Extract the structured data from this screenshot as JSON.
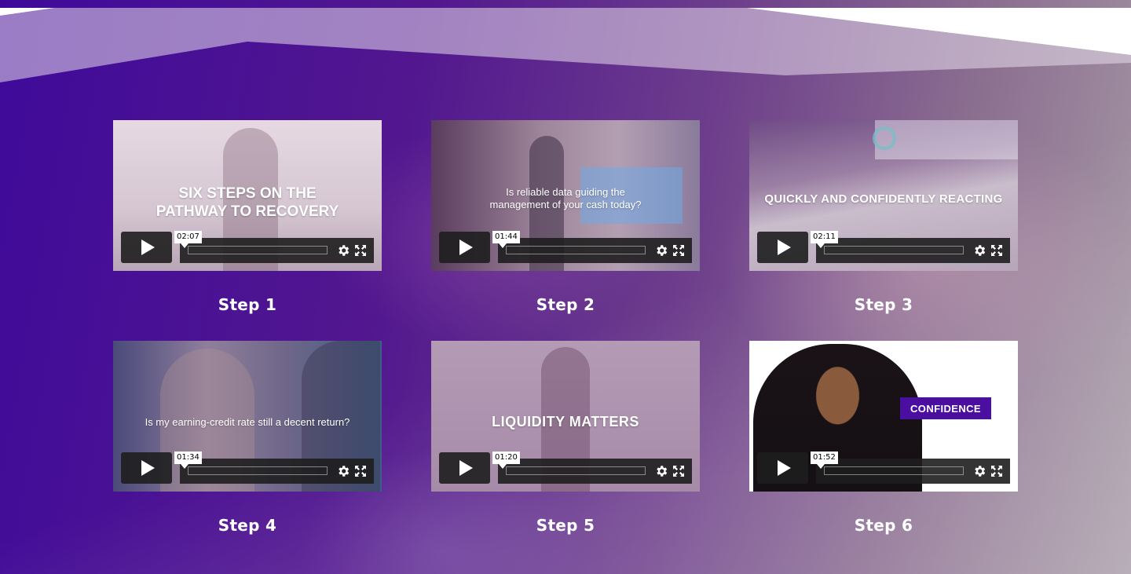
{
  "videos": [
    {
      "step_label": "Step 1",
      "overlay_line1": "SIX STEPS ON THE",
      "overlay_line2": "PATHWAY TO RECOVERY",
      "duration": "02:07",
      "palette": [
        "#e2d4dc",
        "#c7b6c3"
      ]
    },
    {
      "step_label": "Step 2",
      "overlay_line1": "Is reliable data guiding the",
      "overlay_line2": "management of your cash today?",
      "duration": "01:44",
      "palette": [
        "#8b6f8f",
        "#b59eb0"
      ]
    },
    {
      "step_label": "Step 3",
      "overlay_line1": "QUICKLY AND CONFIDENTLY REACTING",
      "overlay_line2": "",
      "duration": "02:11",
      "palette": [
        "#8a6a92",
        "#b6a0b8"
      ]
    },
    {
      "step_label": "Step 4",
      "overlay_line1": "Is my earning-credit rate still a decent return?",
      "overlay_line2": "",
      "duration": "01:34",
      "palette": [
        "#5d4a7a",
        "#9b8cab"
      ]
    },
    {
      "step_label": "Step 5",
      "overlay_line1": "LIQUIDITY MATTERS",
      "overlay_line2": "",
      "duration": "01:20",
      "palette": [
        "#a98eae",
        "#b79db6"
      ]
    },
    {
      "step_label": "Step 6",
      "overlay_line1": "CONFIDENCE",
      "overlay_line2": "",
      "duration": "01:52",
      "palette": [
        "#ffffff",
        "#f4f2f6"
      ]
    }
  ],
  "colors": {
    "brand_purple": "#4b0fa0",
    "confidence_badge": "#4b0fa0"
  },
  "icons": {
    "play": "play-icon",
    "settings": "gear-icon",
    "fullscreen": "fullscreen-icon"
  }
}
